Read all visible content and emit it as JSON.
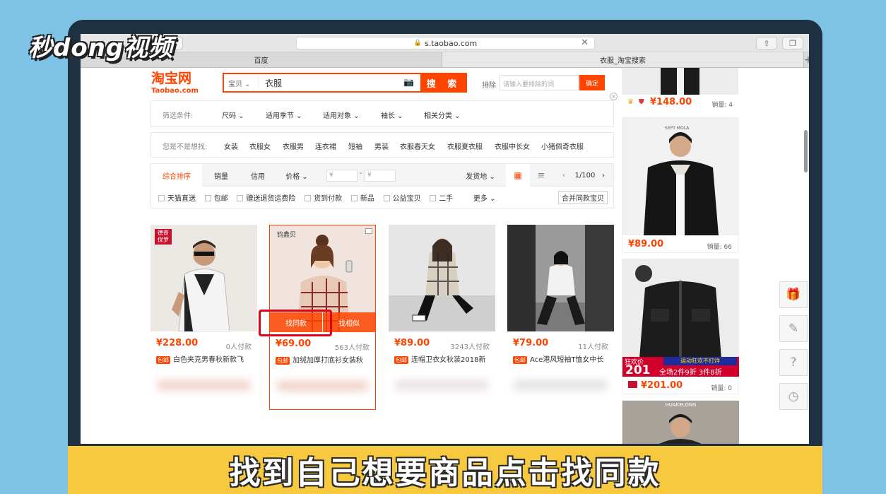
{
  "watermark": {
    "logo": "秒dong视频"
  },
  "browser": {
    "url": "s.taobao.com",
    "tabs": [
      {
        "label": "百度"
      },
      {
        "label": "衣服_淘宝搜索"
      }
    ],
    "new_tab": "+"
  },
  "header": {
    "logo": "淘宝网",
    "logo_sub": "Taobao.com",
    "search_category": "宝贝 ⌄",
    "search_value": "衣服",
    "search_button": "搜 索",
    "exclude_label": "排除",
    "exclude_placeholder": "请输入要排除的词",
    "exclude_button": "确定"
  },
  "filters": {
    "label": "筛选条件:",
    "items": [
      "尺码 ⌄",
      "适用季节 ⌄",
      "适用对象 ⌄",
      "袖长 ⌄",
      "相关分类 ⌄"
    ]
  },
  "suggest": {
    "label": "您是不是想找:",
    "items": [
      "女装",
      "衣服女",
      "衣服男",
      "连衣裙",
      "短袖",
      "男装",
      "衣服春天女",
      "衣服夏衣服",
      "衣服中长女",
      "小猪佩奇衣服"
    ]
  },
  "sort": {
    "tabs": [
      "综合排序",
      "销量",
      "信用",
      "价格 ⌄"
    ],
    "price_min": "¥",
    "price_max": "¥",
    "dash": "-",
    "ship_from": "发货地 ⌄",
    "page": "1/100",
    "checks": [
      "天猫直送",
      "包邮",
      "赠送退货运费险",
      "货到付款",
      "新品",
      "公益宝贝",
      "二手"
    ],
    "more": "更多 ⌄",
    "merge_button": "合并同款宝贝"
  },
  "products": [
    {
      "price": "¥228.00",
      "sales": "0人付款",
      "baoyou": "包邮",
      "title": "白色夹克男春秋新款飞",
      "badge": "德奇保罗"
    },
    {
      "price": "¥69.00",
      "sales": "563人付款",
      "baoyou": "包邮",
      "title": "加绒加厚打底衫女装秋",
      "brand": "钧鑫贝",
      "find_same": "找同款",
      "find_similar": "找相似"
    },
    {
      "price": "¥89.00",
      "sales": "3243人付款",
      "baoyou": "包邮",
      "title": "连帽卫衣女秋装2018新"
    },
    {
      "price": "¥79.00",
      "sales": "11人付款",
      "baoyou": "包邮",
      "title": "Ace港风短袖T恤女中长"
    }
  ],
  "right_col": [
    {
      "price": "¥148.00",
      "sales": "销量: 4"
    },
    {
      "price": "¥89.00",
      "sales": "销量: 66"
    },
    {
      "price": "¥201.00",
      "sales": "销量: 0",
      "promo_main": "狂欢价",
      "promo_price": "201",
      "promo_line1": "运动狂欢不打烊",
      "promo_line2": "全场2件9折 3件8折"
    },
    {
      "brand": "HUAKELONG"
    }
  ],
  "side_tools": [
    "gift-icon",
    "edit-icon",
    "help-icon",
    "history-icon"
  ],
  "caption": "找到自己想要商品点击找同款",
  "colors": {
    "accent": "#ff4400",
    "caption_bg": "#f7c93e",
    "frame": "#1d3142",
    "background": "#7ec2e6"
  }
}
